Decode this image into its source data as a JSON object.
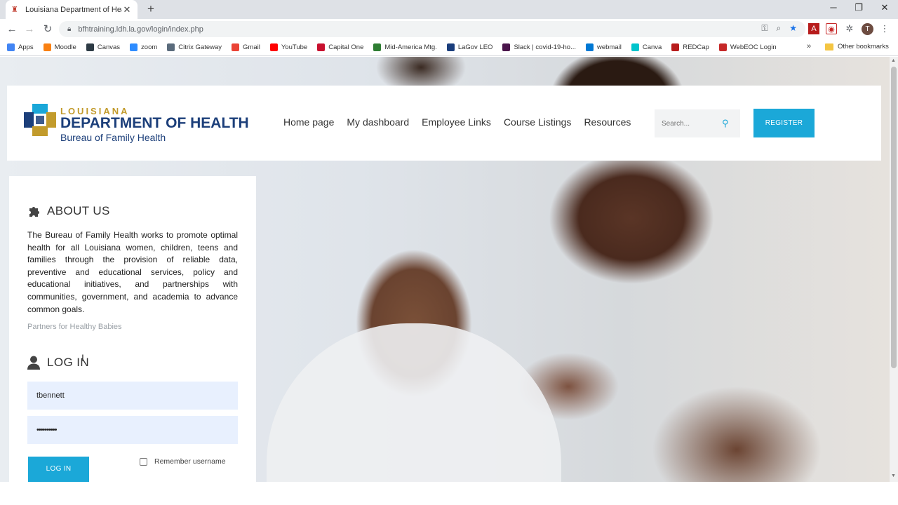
{
  "browser": {
    "tab_title": "Louisiana Department of Health",
    "url": "bfhtraining.ldh.la.gov/login/index.php",
    "avatar_letter": "T",
    "bookmarks": [
      {
        "label": "Apps",
        "icon": "apps-grid-icon",
        "color": "#4285f4"
      },
      {
        "label": "Moodle",
        "icon": "moodle-icon",
        "color": "#f98012"
      },
      {
        "label": "Canvas",
        "icon": "canvas-icon",
        "color": "#2d3b45"
      },
      {
        "label": "zoom",
        "icon": "zoom-icon",
        "color": "#2d8cff"
      },
      {
        "label": "Citrix Gateway",
        "icon": "citrix-icon",
        "color": "#5a6b7c"
      },
      {
        "label": "Gmail",
        "icon": "google-icon",
        "color": "#ea4335"
      },
      {
        "label": "YouTube",
        "icon": "youtube-icon",
        "color": "#ff0000"
      },
      {
        "label": "Capital One",
        "icon": "capital-one-icon",
        "color": "#c8102e"
      },
      {
        "label": "Mid-America Mtg.",
        "icon": "mortgage-icon",
        "color": "#2e7d32"
      },
      {
        "label": "LaGov LEO",
        "icon": "lagov-icon",
        "color": "#1a3d7c"
      },
      {
        "label": "Slack | covid-19-ho...",
        "icon": "slack-icon",
        "color": "#4a154b"
      },
      {
        "label": "webmail",
        "icon": "outlook-icon",
        "color": "#0078d4"
      },
      {
        "label": "Canva",
        "icon": "canva-icon",
        "color": "#00c4cc"
      },
      {
        "label": "REDCap",
        "icon": "redcap-icon",
        "color": "#b71c1c"
      },
      {
        "label": "WebEOC Login",
        "icon": "webeoc-icon",
        "color": "#c62828"
      }
    ],
    "other_bookmarks": "Other bookmarks",
    "more_bookmarks": "»"
  },
  "header": {
    "logo_line1": "LOUISIANA",
    "logo_line2": "DEPARTMENT OF HEALTH",
    "logo_line3": "Bureau of Family Health",
    "nav": [
      "Home page",
      "My dashboard",
      "Employee Links",
      "Course Listings",
      "Resources"
    ],
    "search_placeholder": "Search...",
    "register_label": "REGISTER"
  },
  "about": {
    "title": "ABOUT US",
    "text": "The Bureau of Family Health works to promote optimal health for all Louisiana women, children, teens and families through the provision of reliable data, preventive and educational services, policy and educational initiatives, and partnerships with communities, government, and academia to advance common goals.",
    "partners_link": "Partners for Healthy Babies"
  },
  "login": {
    "title": "LOG IN",
    "username_value": "tbennett",
    "password_value": "••••••••••",
    "button_label": "LOG IN",
    "remember_label": "Remember username"
  },
  "colors": {
    "accent": "#1ba8d8",
    "brand_blue": "#1c3f7a",
    "brand_gold": "#c29b2c"
  }
}
